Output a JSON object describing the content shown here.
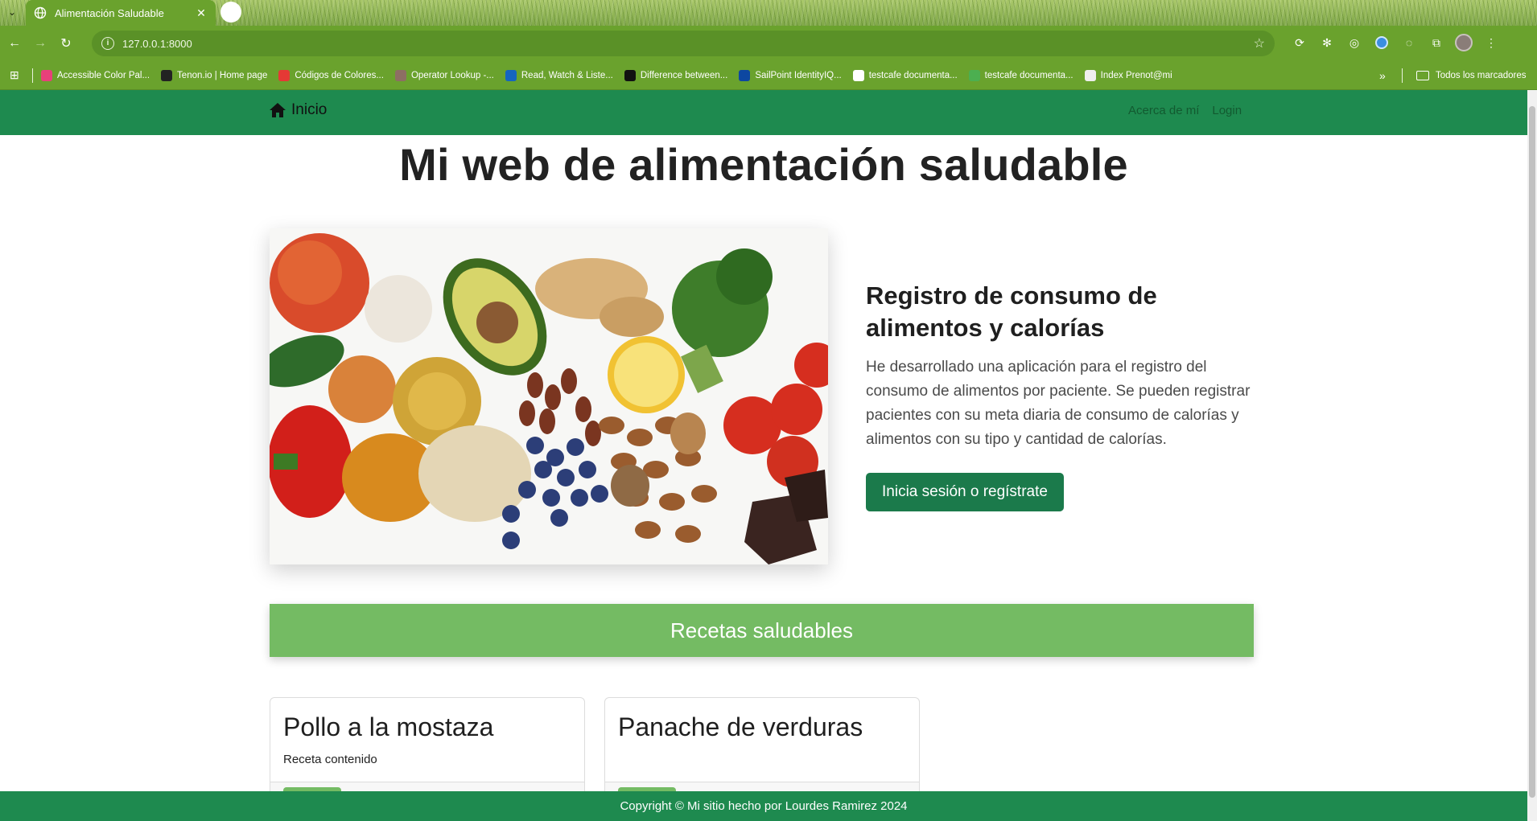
{
  "browser": {
    "tab_title": "Alimentación Saludable",
    "url": "127.0.0.1:8000",
    "bookmarks": [
      {
        "label": "Accessible Color Pal...",
        "color": "#e8407a"
      },
      {
        "label": "Tenon.io | Home page",
        "color": "#222222"
      },
      {
        "label": "Códigos de Colores...",
        "color": "#e53935"
      },
      {
        "label": "Operator Lookup -...",
        "color": "#8d6e63"
      },
      {
        "label": "Read, Watch & Liste...",
        "color": "#1565c0"
      },
      {
        "label": "Difference between...",
        "color": "#111111"
      },
      {
        "label": "SailPoint IdentityIQ...",
        "color": "#0d47a1"
      },
      {
        "label": "testcafe documenta...",
        "color": "#ffffff"
      },
      {
        "label": "testcafe documenta...",
        "color": "#4caf50"
      },
      {
        "label": "Index Prenot@mi",
        "color": "#eeeeee"
      }
    ],
    "all_bookmarks": "Todos los marcadores"
  },
  "navbar": {
    "brand": "Inicio",
    "links": [
      "Acerca de mí",
      "Login"
    ]
  },
  "page": {
    "title": "Mi web de alimentación saludable",
    "hero": {
      "heading": "Registro de consumo de alimentos y calorías",
      "description": "He desarrollado una aplicación para el registro del consumo de alimentos por paciente. Se pueden registrar pacientes con su meta diaria de consumo de calorías y alimentos con su tipo y cantidad de calorías.",
      "cta": "Inicia sesión o regístrate"
    },
    "recipes_banner": "Recetas saludables",
    "cards": [
      {
        "title": "Pollo a la mostaza",
        "body": "Receta contenido"
      },
      {
        "title": "Panache de verduras",
        "body": ""
      }
    ]
  },
  "footer": {
    "text": "Copyright © Mi sitio hecho por Lourdes Ramirez 2024"
  },
  "colors": {
    "navbar": "#1e8a4f",
    "button": "#1b7a4b",
    "banner": "#74bb63",
    "browser_frame": "#6aa22d"
  }
}
